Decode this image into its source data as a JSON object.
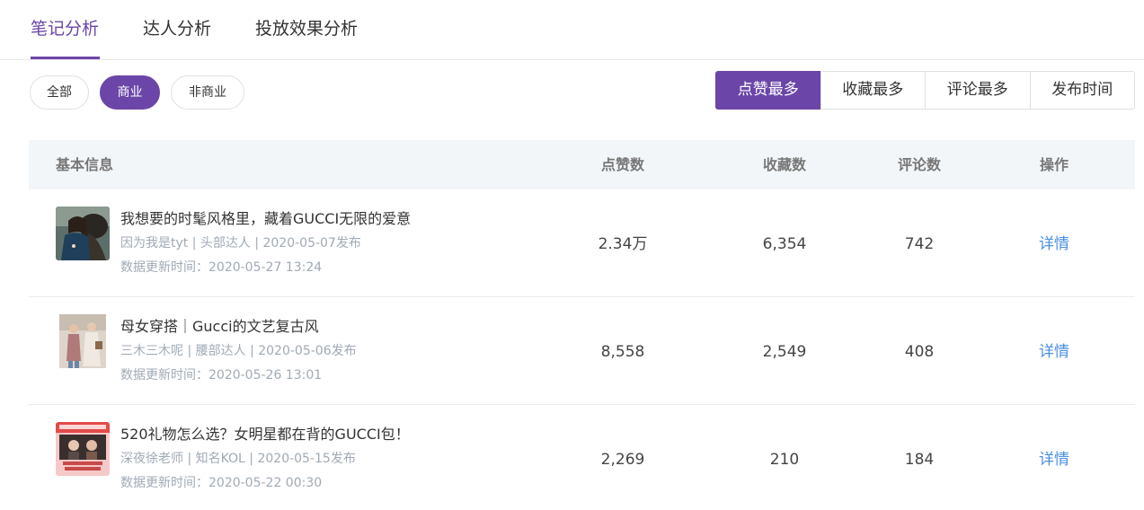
{
  "tabs": [
    {
      "label": "笔记分析",
      "active": true
    },
    {
      "label": "达人分析",
      "active": false
    },
    {
      "label": "投放效果分析",
      "active": false
    }
  ],
  "filters": [
    {
      "label": "全部",
      "active": false
    },
    {
      "label": "商业",
      "active": true
    },
    {
      "label": "非商业",
      "active": false
    }
  ],
  "sort_options": [
    {
      "label": "点赞最多",
      "active": true
    },
    {
      "label": "收藏最多",
      "active": false
    },
    {
      "label": "评论最多",
      "active": false
    },
    {
      "label": "发布时间",
      "active": false
    }
  ],
  "accent_color": "#6b46a8",
  "link_color": "#4a90e2",
  "table": {
    "headers": {
      "basic_info": "基本信息",
      "likes": "点赞数",
      "collects": "收藏数",
      "comments": "评论数",
      "action": "操作"
    },
    "rows": [
      {
        "title": "我想要的时髦风格里，藏着GUCCI无限的爱意",
        "meta": "因为我是tyt | 头部达人 | 2020-05-07发布",
        "updated": "数据更新时间：2020-05-27 13:24",
        "likes": "2.34万",
        "collects": "6,354",
        "comments": "742",
        "action": "详情"
      },
      {
        "title": "母女穿搭｜Gucci的文艺复古风",
        "meta": "三木三木呢 | 腰部达人 | 2020-05-06发布",
        "updated": "数据更新时间：2020-05-26 13:01",
        "likes": "8,558",
        "collects": "2,549",
        "comments": "408",
        "action": "详情"
      },
      {
        "title": "520礼物怎么选？女明星都在背的GUCCI包！",
        "meta": "深夜徐老师 | 知名KOL | 2020-05-15发布",
        "updated": "数据更新时间：2020-05-22 00:30",
        "likes": "2,269",
        "collects": "210",
        "comments": "184",
        "action": "详情"
      }
    ]
  }
}
